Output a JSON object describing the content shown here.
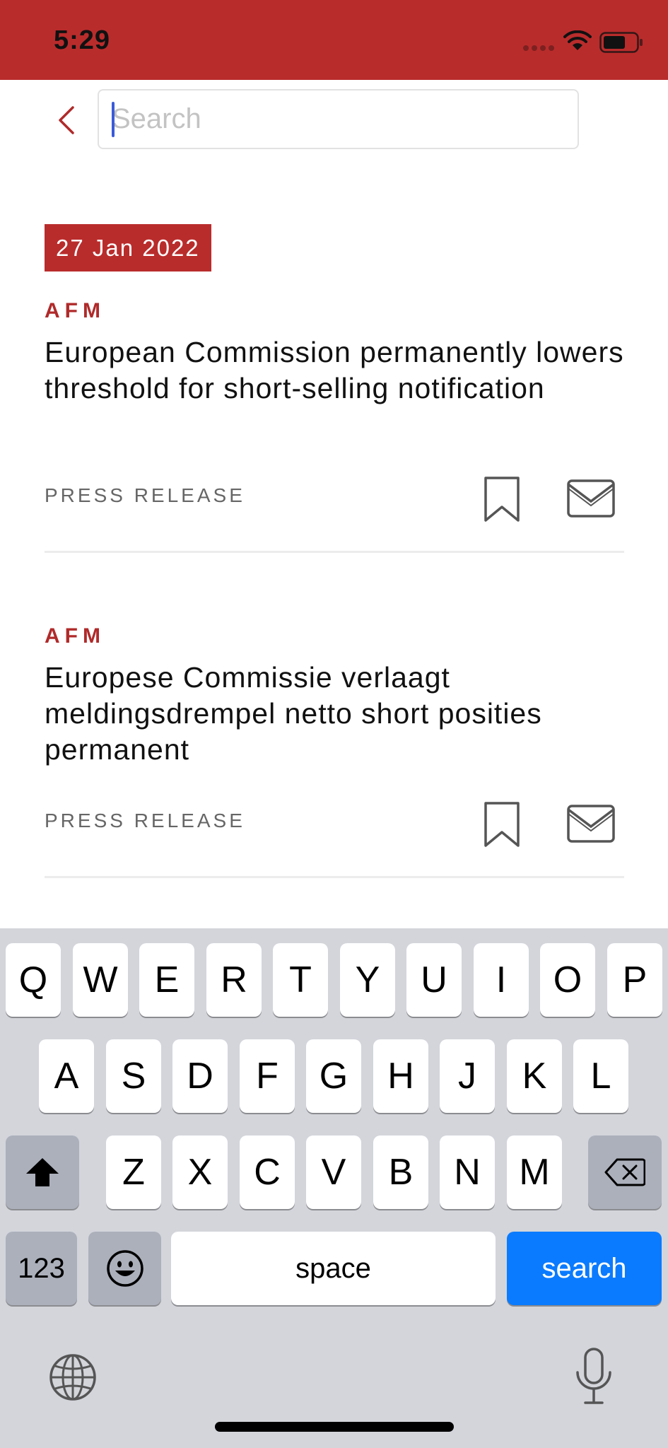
{
  "status_bar": {
    "time": "5:29"
  },
  "search": {
    "placeholder": "Search",
    "value": ""
  },
  "date_badge": "27 Jan 2022",
  "articles": [
    {
      "source": "AFM",
      "title": "European Commission permanently lowers threshold for short-selling notification",
      "type": "PRESS RELEASE"
    },
    {
      "source": "AFM",
      "title": "Europese Commissie verlaagt meldingsdrempel netto short posities permanent",
      "type": "PRESS RELEASE"
    }
  ],
  "keyboard": {
    "row1": [
      "Q",
      "W",
      "E",
      "R",
      "T",
      "Y",
      "U",
      "I",
      "O",
      "P"
    ],
    "row2": [
      "A",
      "S",
      "D",
      "F",
      "G",
      "H",
      "J",
      "K",
      "L"
    ],
    "row3": [
      "Z",
      "X",
      "C",
      "V",
      "B",
      "N",
      "M"
    ],
    "numbers_label": "123",
    "space_label": "space",
    "action_label": "search"
  },
  "colors": {
    "brand_red": "#b92c2c",
    "keyboard_action_blue": "#0a7bfe"
  }
}
